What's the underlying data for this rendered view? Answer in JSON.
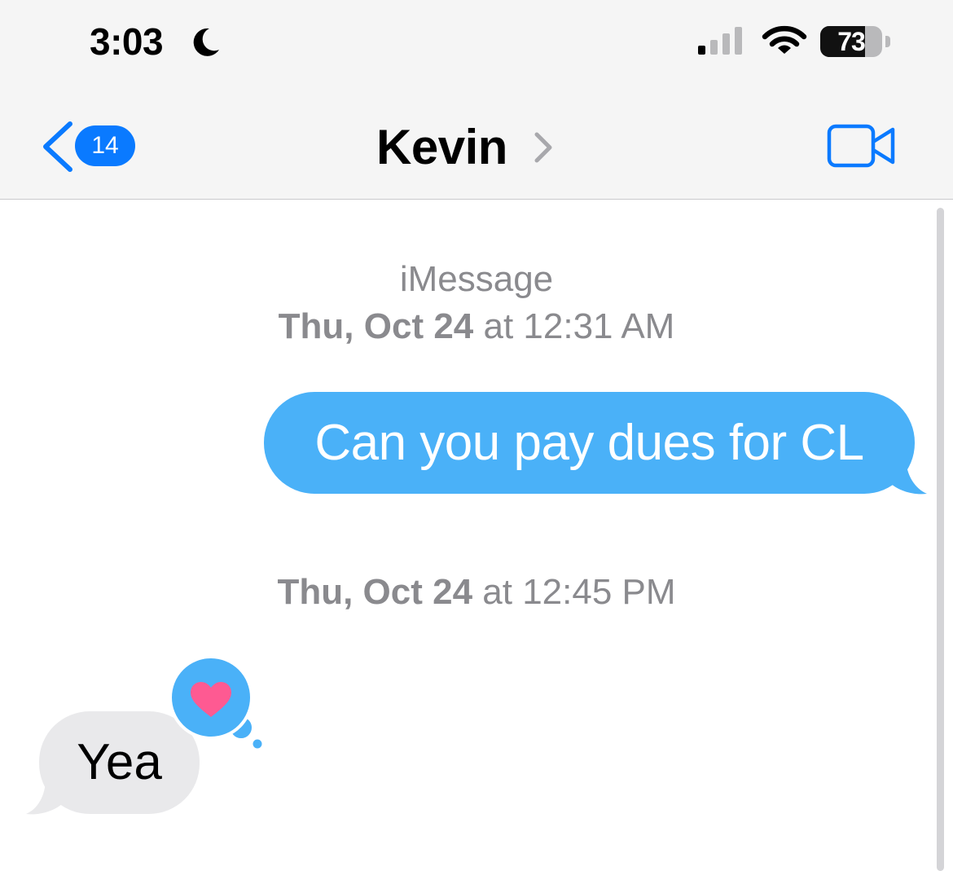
{
  "status_bar": {
    "time": "3:03",
    "focus_icon": "moon-icon",
    "signal_icon": "cellular-signal-icon",
    "wifi_icon": "wifi-icon",
    "battery_percent": "73",
    "battery_level": 0.73
  },
  "nav_bar": {
    "back_icon": "chevron-left-icon",
    "unread_count": "14",
    "contact_name": "Kevin",
    "disclosure_icon": "chevron-right-icon",
    "video_call_icon": "video-camera-icon",
    "accent_color": "#0a7aff"
  },
  "conversation": {
    "service_label": "iMessage",
    "timestamp_1": {
      "date": "Thu, Oct 24",
      "at": "at 12:31 AM"
    },
    "outgoing_message": "Can you pay dues for CL",
    "outgoing_color": "#4ab1f8",
    "timestamp_2": {
      "date": "Thu, Oct 24",
      "at": "at 12:45 PM"
    },
    "incoming_message": "Yea",
    "incoming_color": "#e9e9eb",
    "reaction": {
      "icon": "heart-icon",
      "type": "loved",
      "color": "#fe5a92"
    }
  }
}
